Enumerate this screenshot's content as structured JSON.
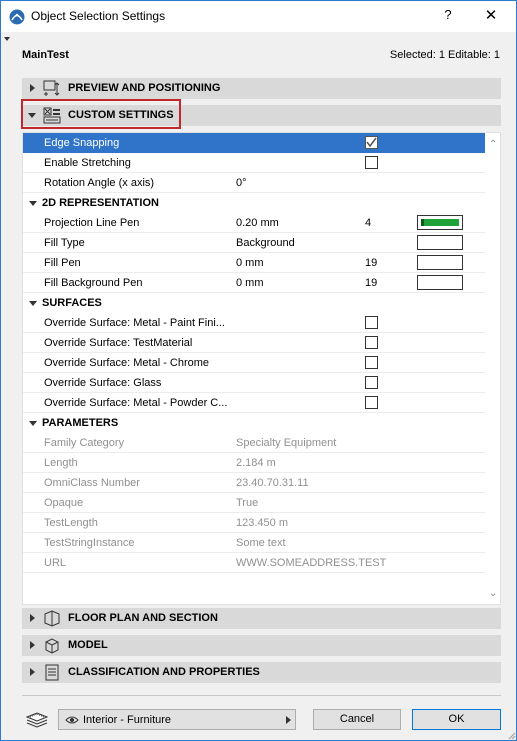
{
  "window": {
    "title": "Object Selection Settings",
    "help_glyph": "?",
    "close_glyph": "✕"
  },
  "header": {
    "object_name": "MainTest",
    "selection_status": "Selected: 1 Editable: 1"
  },
  "sections": {
    "preview": "PREVIEW AND POSITIONING",
    "custom": "CUSTOM SETTINGS",
    "floor_plan": "FLOOR PLAN AND SECTION",
    "model": "MODEL",
    "classification": "CLASSIFICATION AND PROPERTIES"
  },
  "custom_settings": {
    "general": [
      {
        "label": "Edge Snapping",
        "control": "checkbox",
        "checked": true,
        "selected": true
      },
      {
        "label": "Enable Stretching",
        "control": "checkbox",
        "checked": false
      },
      {
        "label": "Rotation Angle (x axis)",
        "value": "0°"
      }
    ],
    "groups": {
      "representation_2d": "2D REPRESENTATION",
      "surfaces": "SURFACES",
      "parameters": "PARAMETERS"
    },
    "representation_2d": [
      {
        "label": "Projection Line Pen",
        "value": "0.20 mm",
        "pen_number": "4",
        "pen_color": "#1fa339"
      },
      {
        "label": "Fill Type",
        "value": "Background"
      },
      {
        "label": "Fill Pen",
        "value": "0 mm",
        "pen_number": "19"
      },
      {
        "label": "Fill Background Pen",
        "value": "0 mm",
        "pen_number": "19"
      }
    ],
    "surfaces": [
      {
        "label": "Override Surface: Metal - Paint Fini...",
        "checked": false
      },
      {
        "label": "Override Surface: TestMaterial",
        "checked": false
      },
      {
        "label": "Override Surface: Metal - Chrome",
        "checked": false
      },
      {
        "label": "Override Surface: Glass",
        "checked": false
      },
      {
        "label": "Override Surface: Metal - Powder C...",
        "checked": false
      }
    ],
    "parameters": [
      {
        "label": "Family Category",
        "value": "Specialty Equipment"
      },
      {
        "label": "Length",
        "value": "2.184 m"
      },
      {
        "label": "OmniClass Number",
        "value": "23.40.70.31.11"
      },
      {
        "label": "Opaque",
        "value": "True"
      },
      {
        "label": "TestLength",
        "value": "123.450 m"
      },
      {
        "label": "TestStringInstance",
        "value": "Some text"
      },
      {
        "label": "URL",
        "value": "WWW.SOMEADDRESS.TEST"
      }
    ]
  },
  "footer": {
    "layer_dropdown": "Interior - Furniture",
    "cancel_label": "Cancel",
    "ok_label": "OK"
  },
  "colors": {
    "selection": "#2f74c9",
    "highlight_box": "#c0282b",
    "pen_green": "#1fa339"
  }
}
